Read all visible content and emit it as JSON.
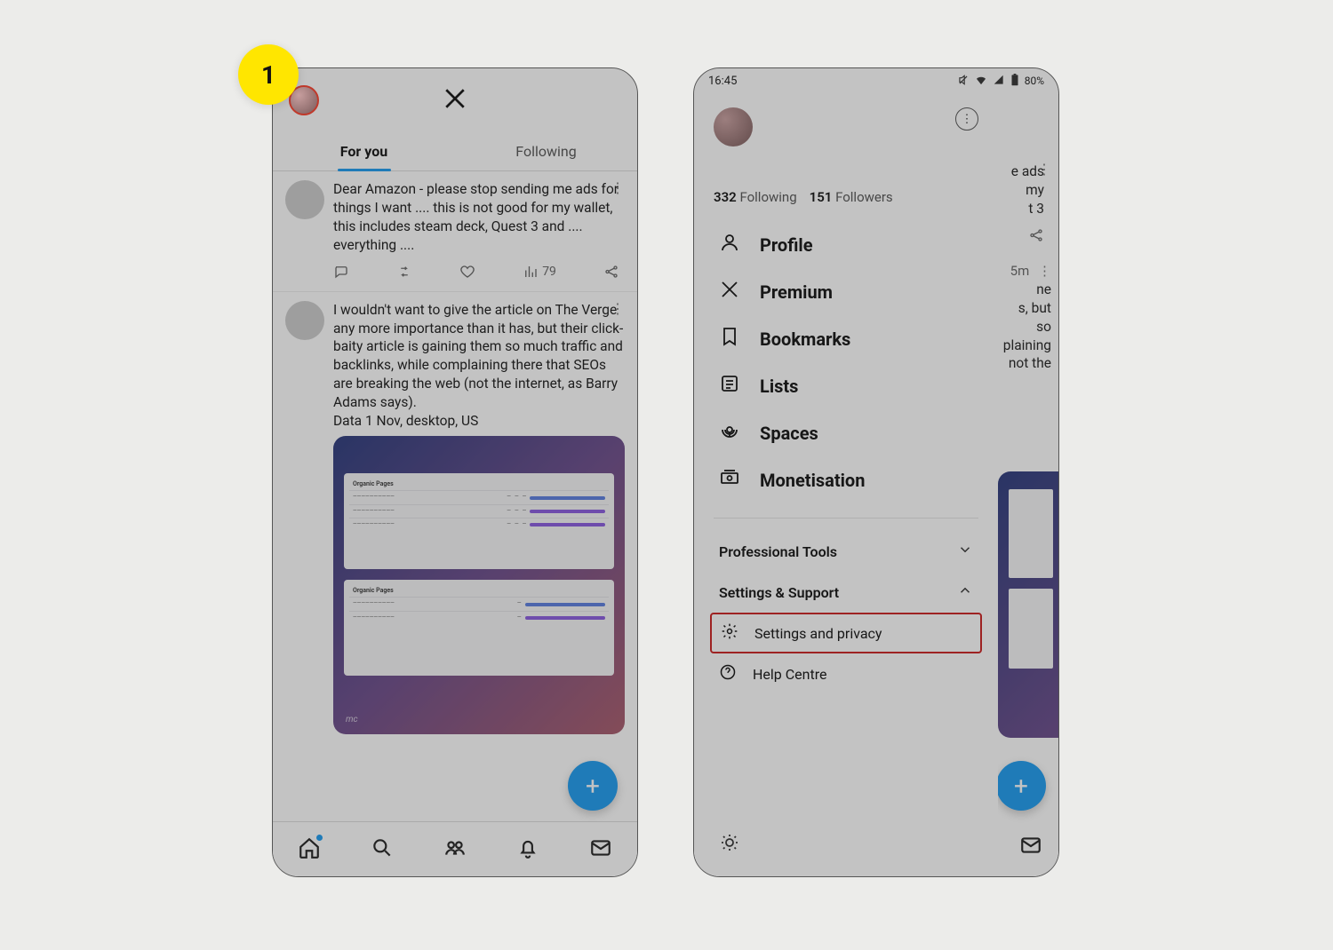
{
  "annotation": {
    "badge": "1"
  },
  "phone1": {
    "tabs": {
      "for_you": "For you",
      "following": "Following"
    },
    "posts": [
      {
        "text": "Dear Amazon - please stop sending me ads for things I want .... this is not good for my wallet, this includes steam deck, Quest 3 and .... everything ....",
        "views": "79"
      },
      {
        "text": "I wouldn't want to give the article on The Verge any more importance than it has, but their click-baity article is gaining them so much traffic and backlinks, while complaining there that SEOs are breaking the web (not the internet, as Barry Adams says).",
        "data_line": "Data 1 Nov, desktop, US"
      }
    ],
    "image_panel_label": "Organic Pages"
  },
  "phone2": {
    "status": {
      "time": "16:45",
      "battery": "80%"
    },
    "stats": {
      "following_count": "332",
      "following_label": "Following",
      "followers_count": "151",
      "followers_label": "Followers"
    },
    "menu": {
      "profile": "Profile",
      "premium": "Premium",
      "bookmarks": "Bookmarks",
      "lists": "Lists",
      "spaces": "Spaces",
      "monetisation": "Monetisation"
    },
    "expanders": {
      "pro_tools": "Professional Tools",
      "settings_support": "Settings & Support"
    },
    "sub": {
      "settings_privacy": "Settings and privacy",
      "help": "Help Centre"
    },
    "peek": {
      "p1_frag": "e ads my t 3",
      "p2_time": "5m",
      "p2_frag": "ne s, but so plaining not the"
    }
  }
}
